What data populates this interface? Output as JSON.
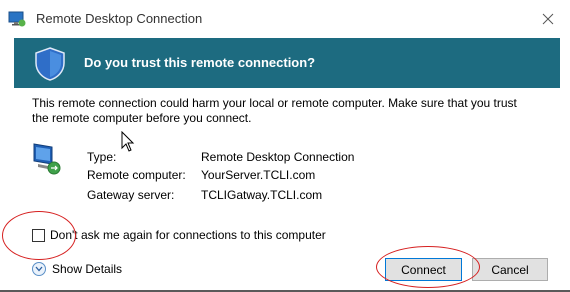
{
  "window": {
    "title": "Remote Desktop Connection",
    "close_glyph": "✕"
  },
  "banner": {
    "heading": "Do you trust this remote connection?",
    "color": "#1d6b80"
  },
  "warning_text": "This remote connection could harm your local or remote computer. Make sure that you trust the remote computer before you connect.",
  "details": [
    {
      "label": "Type:",
      "value": "Remote Desktop Connection"
    },
    {
      "label": "Remote computer:",
      "value": "YourServer.TCLI.com"
    },
    {
      "label": "Gateway server:",
      "value": "TCLIGatway.TCLI.com"
    }
  ],
  "checkbox": {
    "label": "Don't ask me again for connections to this computer",
    "checked": false
  },
  "show_details": {
    "label": "Show Details"
  },
  "buttons": {
    "connect": "Connect",
    "cancel": "Cancel"
  },
  "annotation_color": "#d62020"
}
